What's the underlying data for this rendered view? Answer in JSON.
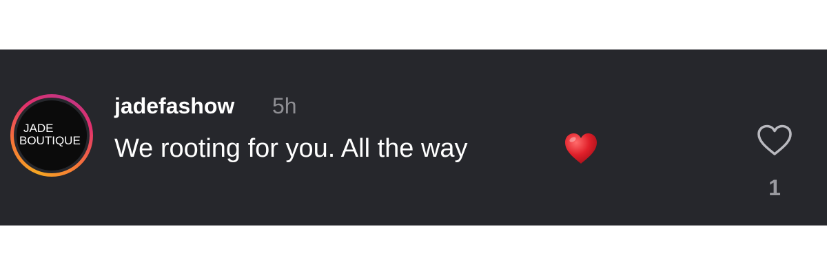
{
  "comment": {
    "avatar": {
      "logo_line1": "JADE",
      "logo_line2": "BOUTIQUE"
    },
    "username": "jadefashow",
    "time": "5h",
    "text": "We rooting for you. All the way",
    "emoji": "red-heart-emoji",
    "like_icon": "heart-outline-icon",
    "like_count": "1"
  },
  "colors": {
    "card_background": "#26272c",
    "page_background": "#ffffff",
    "text_primary": "#ffffff",
    "text_secondary": "#8e8e93",
    "emoji_heart": "#e0202a"
  }
}
